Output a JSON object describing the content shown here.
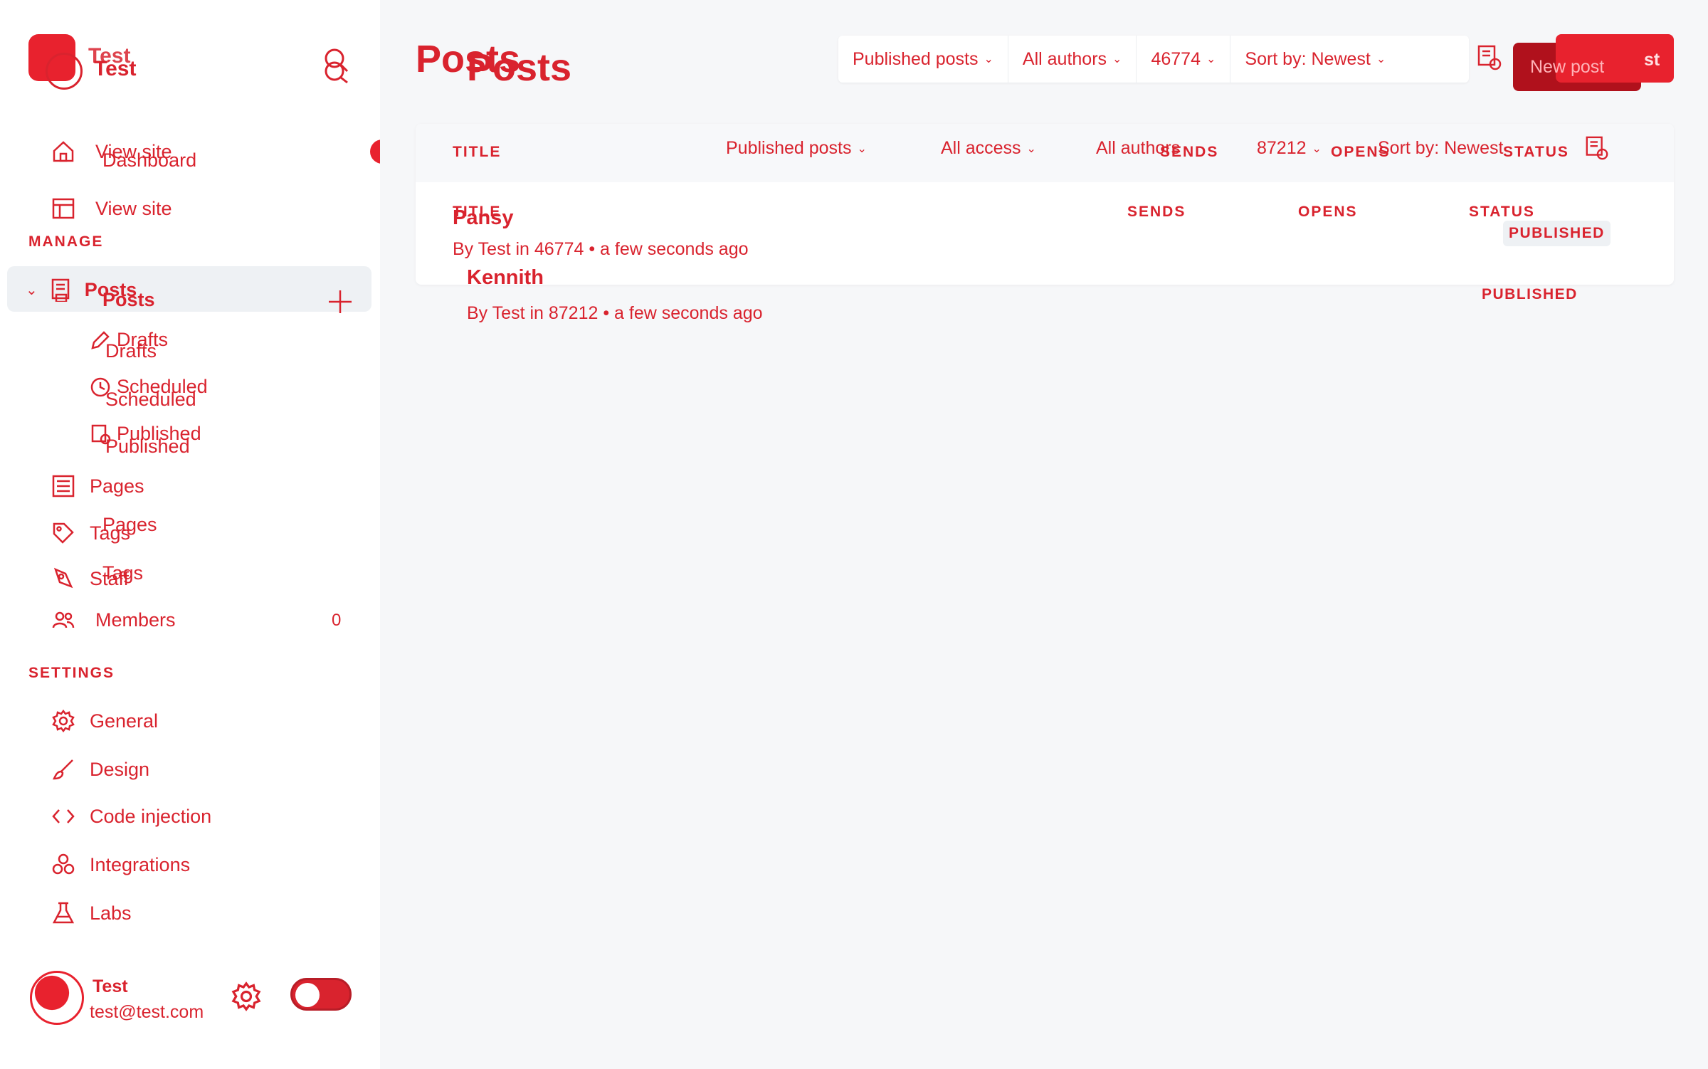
{
  "brand": {
    "name": "Test"
  },
  "sidebar": {
    "top_items": [
      {
        "label": "View site",
        "ghost": "Dashboard"
      },
      {
        "label": "View site"
      }
    ],
    "manage_title": "MANAGE",
    "posts": {
      "label": "Posts",
      "ghost": "Posts"
    },
    "post_subitems": [
      {
        "label": "Drafts",
        "ghost": "Drafts"
      },
      {
        "label": "Scheduled",
        "ghost": "Scheduled"
      },
      {
        "label": "Published",
        "ghost": "Published"
      }
    ],
    "pages": {
      "label": "Pages",
      "ghost": "Pages"
    },
    "tags": {
      "label": "Tags",
      "ghost": "Tags"
    },
    "staff": {
      "label": "Staff"
    },
    "members": {
      "label": "Members",
      "count": "0"
    },
    "settings_title": "SETTINGS",
    "settings_items": [
      {
        "label": "General"
      },
      {
        "label": "Design"
      },
      {
        "label": "Code injection"
      },
      {
        "label": "Integrations"
      },
      {
        "label": "Labs"
      }
    ],
    "user": {
      "name": "Test",
      "email": "test@test.com"
    }
  },
  "header": {
    "title": "Posts",
    "title_ghost": "Posts",
    "filters": [
      {
        "label": "Published posts"
      },
      {
        "label": "All authors"
      },
      {
        "label": "46774"
      },
      {
        "label": "Sort by: Newest"
      }
    ],
    "new_post_label": "New post",
    "new_post_fragment": "st"
  },
  "table": {
    "headers": {
      "title": "TITLE",
      "sends": "SENDS",
      "opens": "OPENS",
      "status": "STATUS"
    },
    "headers_ghost": {
      "title": "TITLE",
      "sends": "SENDS",
      "opens": "OPENS",
      "status": "STATUS"
    },
    "inline_filters": [
      {
        "label": "Published posts"
      },
      {
        "label": "All access"
      },
      {
        "label": "All authors"
      },
      {
        "label": "87212"
      },
      {
        "label": "Sort by: Newest"
      }
    ],
    "rows": [
      {
        "title": "Pansy",
        "meta": "By Test in 46774 • a few seconds ago",
        "status": "PUBLISHED"
      },
      {
        "title": "Kennith",
        "meta": "By Test in 87212 • a few seconds ago",
        "status": "PUBLISHED"
      }
    ]
  }
}
